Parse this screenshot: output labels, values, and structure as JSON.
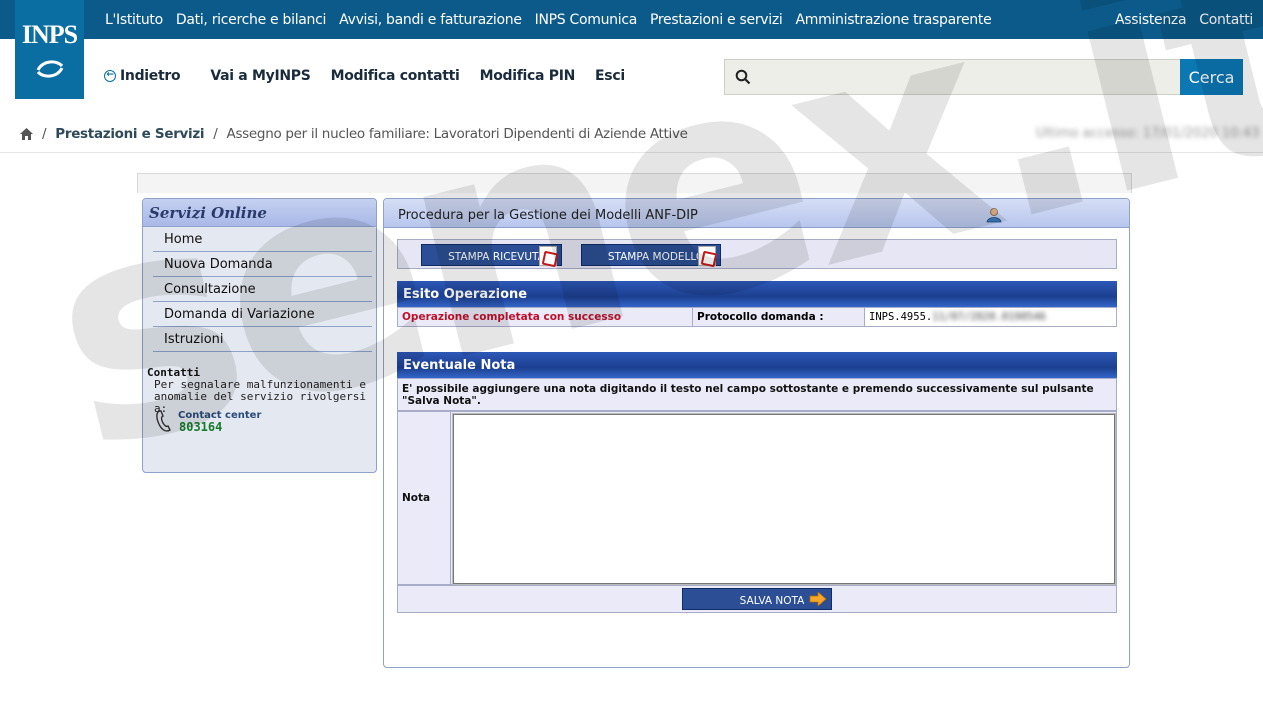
{
  "topnav": {
    "items": [
      "L'Istituto",
      "Dati, ricerche e bilanci",
      "Avvisi, bandi e fatturazione",
      "INPS Comunica",
      "Prestazioni e servizi",
      "Amministrazione trasparente"
    ],
    "right": [
      "Assistenza",
      "Contatti"
    ]
  },
  "logo": {
    "text": "INPS"
  },
  "subnav": {
    "back": "Indietro",
    "items": [
      "Vai a MyINPS",
      "Modifica contatti",
      "Modifica PIN",
      "Esci"
    ]
  },
  "search": {
    "placeholder": "",
    "button": "Cerca"
  },
  "breadcrumb": {
    "level1": "Prestazioni e Servizi",
    "level2": "Assegno per il nucleo familiare: Lavoratori Dipendenti di Aziende Attive",
    "last_access": "Ultimo accesso: 17/01/2020 10:43"
  },
  "sidebar": {
    "title": "Servizi Online",
    "items": [
      "Home",
      "Nuova Domanda",
      "Consultazione",
      "Domanda di Variazione",
      "Istruzioni"
    ],
    "contact_title": "Contatti",
    "contact_text": "Per segnalare malfunzionamenti e anomalie del servizio rivolgersi a:",
    "contact_center_label": "Contact center",
    "contact_center_number": "803164"
  },
  "main": {
    "title": "Procedura per la Gestione dei Modelli ANF-DIP",
    "buttons": {
      "stampa_ricevuta": "STAMPA RICEVUTA",
      "stampa_modello": "STAMPA MODELLO"
    },
    "esito": {
      "heading": "Esito Operazione",
      "status": "Operazione completata con successo",
      "protocollo_label": "Protocollo domanda :",
      "protocollo_value": "INPS.4955.",
      "protocollo_hidden": "11/07/2020.0190546"
    },
    "nota": {
      "heading": "Eventuale Nota",
      "description": "E' possibile aggiungere una nota digitando il testo nel campo sottostante e premendo successivamente sul pulsante \"Salva Nota\".",
      "label": "Nota",
      "value": "",
      "save_button": "SALVA NOTA"
    }
  },
  "watermark": "senex.it",
  "colors": {
    "topbar": "#0b5a8a",
    "success_text": "#c0102a",
    "section_header": "#1c3f8f"
  }
}
